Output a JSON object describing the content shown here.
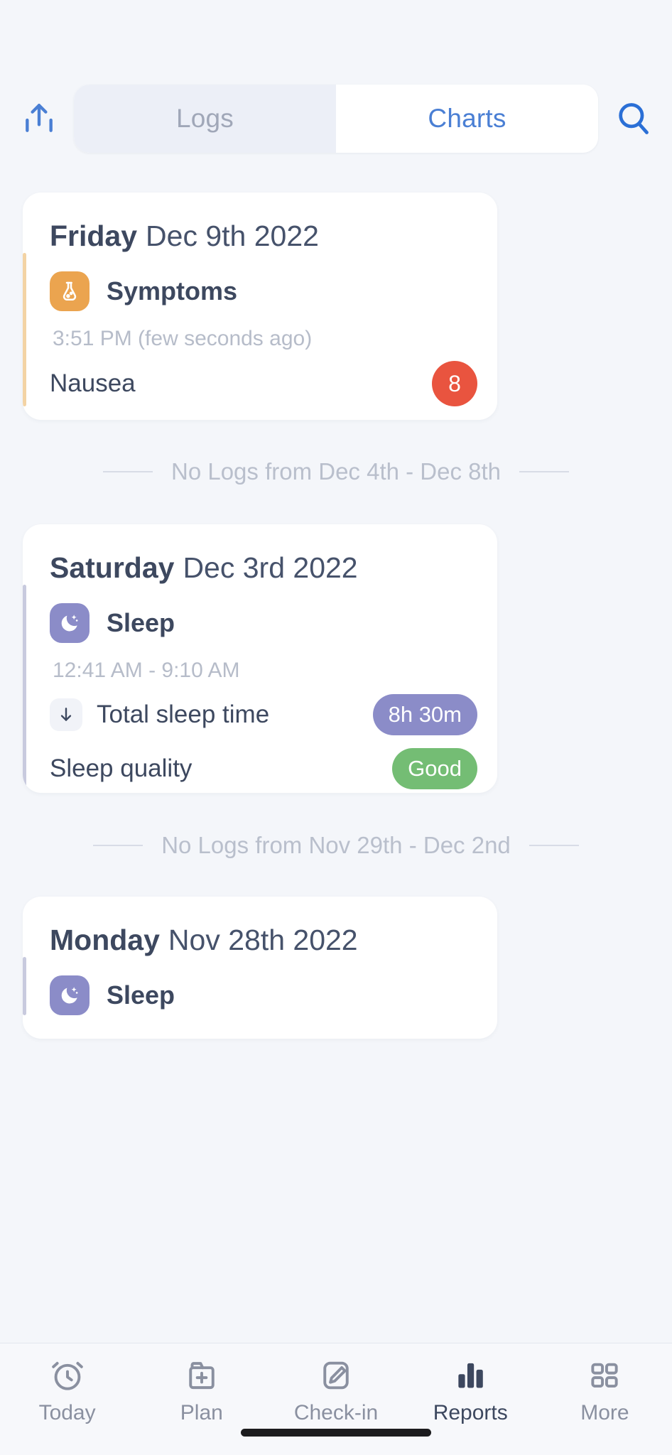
{
  "header": {
    "export_icon": "upload-icon",
    "search_icon": "search-icon",
    "tabs": [
      {
        "label": "Logs",
        "active": false
      },
      {
        "label": "Charts",
        "active": true
      }
    ]
  },
  "colors": {
    "page_background": "#f4f6fa",
    "card_background": "#ffffff",
    "accent_blue": "#4a7fd4",
    "symptoms_orange": "#eba44f",
    "sleep_purple": "#8b8cc8",
    "severity_red": "#e9543f",
    "quality_green": "#74bd74",
    "text_dark": "#3d485f",
    "text_muted": "#b6bcc9"
  },
  "days": [
    {
      "weekday": "Friday",
      "date": "Dec 9th 2022",
      "entries": [
        {
          "type": "Symptoms",
          "icon": "symptoms-icon",
          "icon_color": "#eba44f",
          "bar_color": "#f3d3a4",
          "time": "3:51 PM (few seconds ago)",
          "metrics": [
            {
              "label": "Nausea",
              "value": "8",
              "value_color": "#e9543f",
              "shape": "round",
              "arrow": false
            }
          ]
        }
      ]
    },
    {
      "weekday": "Saturday",
      "date": "Dec 3rd 2022",
      "entries": [
        {
          "type": "Sleep",
          "icon": "sleep-icon",
          "icon_color": "#8b8cc8",
          "bar_color": "#c8cade",
          "time": "12:41 AM - 9:10 AM",
          "metrics": [
            {
              "label": "Total sleep time",
              "value": "8h 30m",
              "value_color": "#8b8cc8",
              "shape": "pill",
              "arrow": true
            },
            {
              "label": "Sleep quality",
              "value": "Good",
              "value_color": "#74bd74",
              "shape": "pill",
              "arrow": false
            }
          ]
        }
      ]
    },
    {
      "weekday": "Monday",
      "date": "Nov 28th 2022",
      "entries": [
        {
          "type": "Sleep",
          "icon": "sleep-icon",
          "icon_color": "#8b8cc8",
          "bar_color": "#c8cade",
          "time": "",
          "metrics": []
        }
      ]
    }
  ],
  "no_log_dividers": [
    {
      "text": "No Logs from Dec 4th  -  Dec 8th"
    },
    {
      "text": "No Logs from Nov 29th  -  Dec 2nd"
    }
  ],
  "bottom_tabs": [
    {
      "label": "Today",
      "icon": "alarm-clock-icon",
      "active": false
    },
    {
      "label": "Plan",
      "icon": "folder-plus-icon",
      "active": false
    },
    {
      "label": "Check-in",
      "icon": "edit-square-icon",
      "active": false
    },
    {
      "label": "Reports",
      "icon": "bar-chart-icon",
      "active": true
    },
    {
      "label": "More",
      "icon": "grid-icon",
      "active": false
    }
  ]
}
